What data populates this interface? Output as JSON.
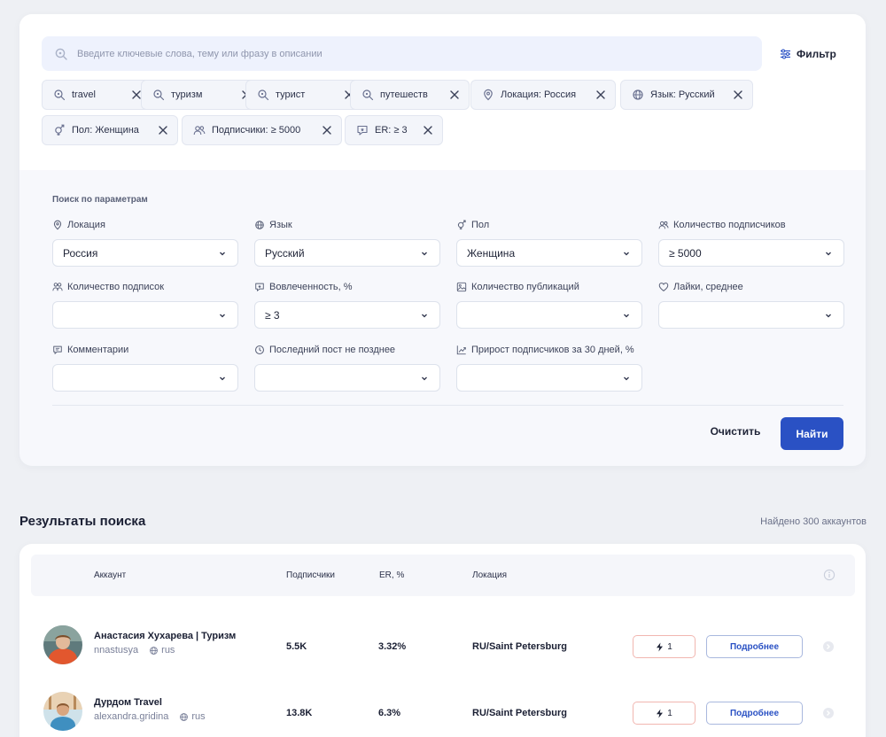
{
  "search": {
    "placeholder": "Введите ключевые слова, тему или фразу в описании",
    "filter_label": "Фильтр"
  },
  "chips": [
    {
      "label": "travel",
      "icon": "keyword-search-icon"
    },
    {
      "label": "туризм",
      "icon": "keyword-search-icon"
    },
    {
      "label": "турист",
      "icon": "keyword-search-icon"
    },
    {
      "label": "путешеств",
      "icon": "keyword-search-icon"
    },
    {
      "label": "Локация: Россия",
      "icon": "location-pin-icon"
    },
    {
      "label": "Язык: Русский",
      "icon": "globe-icon"
    },
    {
      "label": "Пол: Женщина",
      "icon": "gender-icon"
    },
    {
      "label": "Подписчики: ≥ 5000",
      "icon": "users-icon"
    },
    {
      "label": "ER: ≥ 3",
      "icon": "engagement-icon"
    }
  ],
  "params": {
    "title": "Поиск по параметрам",
    "fields": [
      {
        "label": "Локация",
        "value": "Россия",
        "icon": "location-pin-icon"
      },
      {
        "label": "Язык",
        "value": "Русский",
        "icon": "globe-icon"
      },
      {
        "label": "Пол",
        "value": "Женщина",
        "icon": "gender-icon"
      },
      {
        "label": "Количество подписчиков",
        "value": "≥ 5000",
        "icon": "users-icon"
      },
      {
        "label": "Количество подписок",
        "value": "",
        "icon": "following-icon"
      },
      {
        "label": "Вовлеченность, %",
        "value": "≥ 3",
        "icon": "engagement-icon"
      },
      {
        "label": "Количество публикаций",
        "value": "",
        "icon": "image-icon"
      },
      {
        "label": "Лайки, среднее",
        "value": "",
        "icon": "heart-icon"
      },
      {
        "label": "Комментарии",
        "value": "",
        "icon": "comment-icon"
      },
      {
        "label": "Последний пост не позднее",
        "value": "",
        "icon": "clock-icon"
      },
      {
        "label": "Прирост подписчиков за 30 дней, %",
        "value": "",
        "icon": "growth-chart-icon"
      }
    ],
    "clear_label": "Очистить",
    "find_label": "Найти"
  },
  "results": {
    "title": "Результаты поиска",
    "count": "Найдено 300 аккаунтов",
    "columns": {
      "account": "Аккаунт",
      "followers": "Подписчики",
      "er": "ER, %",
      "location": "Локация"
    },
    "rows": [
      {
        "name": "Анастасия Хухарева | Туризм",
        "username": "nnastusya",
        "lang": "rus",
        "followers": "5.5K",
        "er": "3.32%",
        "location": "RU/Saint Petersburg",
        "bolt": "1",
        "more": "Подробнее"
      },
      {
        "name": "Дурдом Travel",
        "username": "alexandra.gridina",
        "lang": "rus",
        "followers": "13.8K",
        "er": "6.3%",
        "location": "RU/Saint Petersburg",
        "bolt": "1",
        "more": "Подробнее"
      }
    ]
  },
  "colors": {
    "accent": "#2a51c4",
    "page_bg": "#eef0f4",
    "search_bg": "#eef2fd",
    "bolt_border": "#f1b6b0"
  }
}
